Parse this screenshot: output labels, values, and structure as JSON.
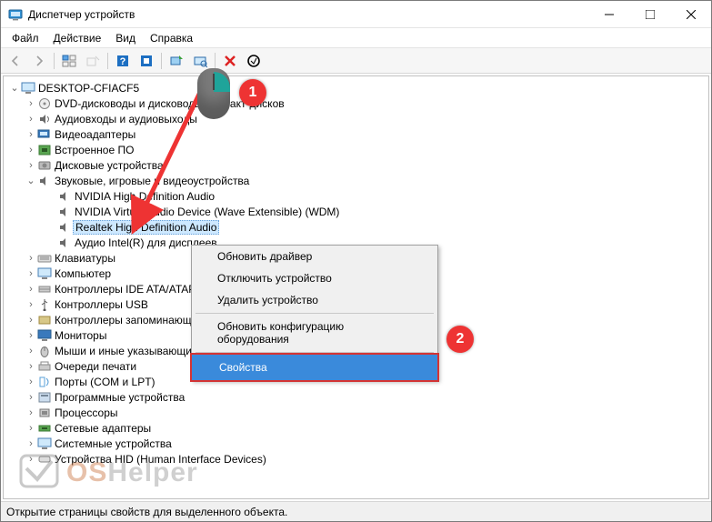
{
  "window": {
    "title": "Диспетчер устройств"
  },
  "menu": {
    "file": "Файл",
    "action": "Действие",
    "view": "Вид",
    "help": "Справка"
  },
  "tree": {
    "root": "DESKTOP-CFIACF5",
    "nodes": [
      {
        "label": "DVD-дисководы и дисководы компакт-дисков"
      },
      {
        "label": "Аудиовходы и аудиовыходы"
      },
      {
        "label": "Видеоадаптеры"
      },
      {
        "label": "Встроенное ПО"
      },
      {
        "label": "Дисковые устройства"
      },
      {
        "label": "Звуковые, игровые и видеоустройства"
      },
      {
        "label": "NVIDIA High Definition Audio"
      },
      {
        "label": "NVIDIA Virtual Audio Device (Wave Extensible) (WDM)"
      },
      {
        "label": "Realtek High Definition Audio"
      },
      {
        "label": "Аудио Intel(R) для дисплеев"
      },
      {
        "label": "Клавиатуры"
      },
      {
        "label": "Компьютер"
      },
      {
        "label": "Контроллеры IDE ATA/ATAPI"
      },
      {
        "label": "Контроллеры USB"
      },
      {
        "label": "Контроллеры запоминающих устройств"
      },
      {
        "label": "Мониторы"
      },
      {
        "label": "Мыши и иные указывающие устройства"
      },
      {
        "label": "Очереди печати"
      },
      {
        "label": "Порты (COM и LPT)"
      },
      {
        "label": "Программные устройства"
      },
      {
        "label": "Процессоры"
      },
      {
        "label": "Сетевые адаптеры"
      },
      {
        "label": "Системные устройства"
      },
      {
        "label": "Устройства HID (Human Interface Devices)"
      }
    ]
  },
  "ctx": {
    "update": "Обновить драйвер",
    "disable": "Отключить устройство",
    "uninstall": "Удалить устройство",
    "scan": "Обновить конфигурацию оборудования",
    "props": "Свойства"
  },
  "status": "Открытие страницы свойств для выделенного объекта.",
  "annotations": {
    "b1": "1",
    "b2": "2"
  }
}
